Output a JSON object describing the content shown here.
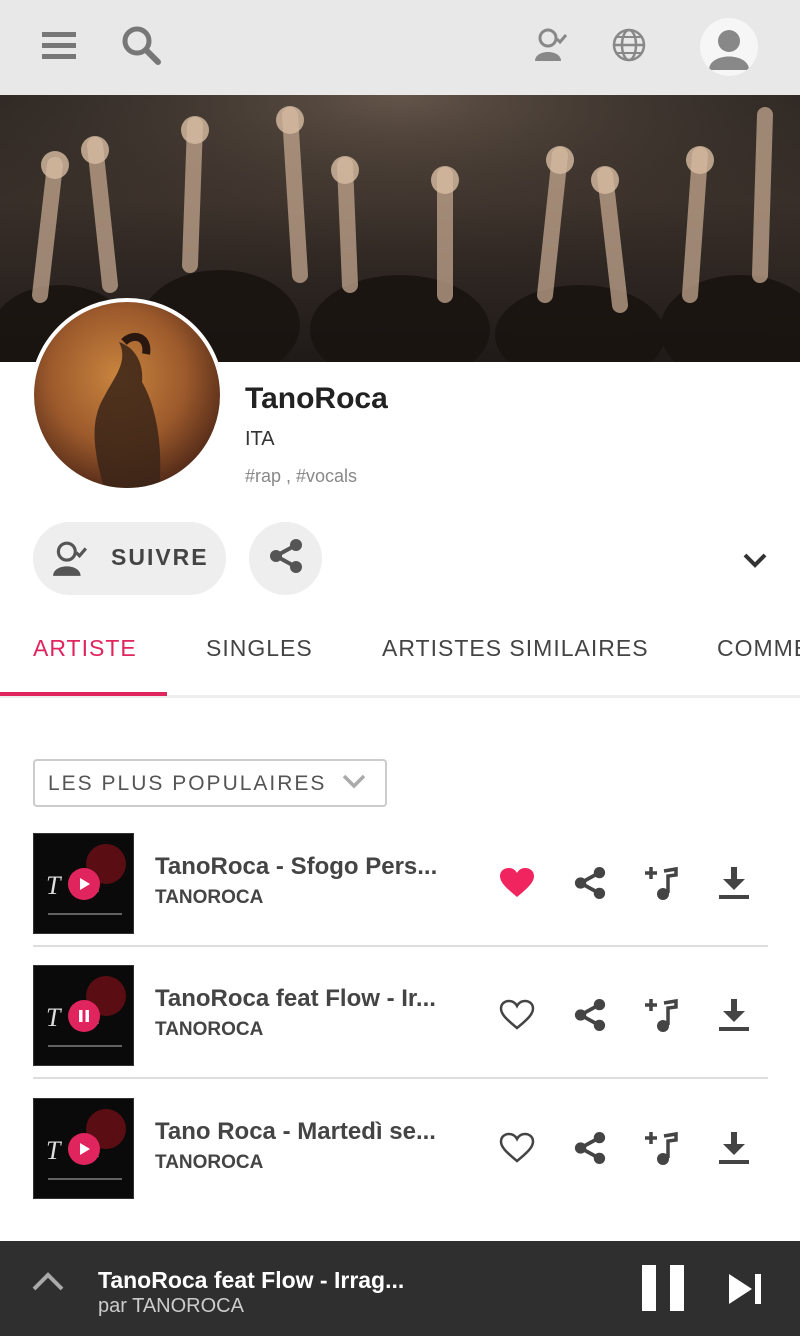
{
  "topbar": {
    "menu_icon": "hamburger-icon",
    "search_icon": "search-icon",
    "user_icon": "user-follow-icon",
    "globe_icon": "globe-icon",
    "avatar_icon": "avatar-icon"
  },
  "artist": {
    "name": "TanoRoca",
    "country": "ITA",
    "tags": "#rap , #vocals"
  },
  "actions": {
    "follow_label": "SUIVRE"
  },
  "tabs": [
    {
      "label": "ARTISTE",
      "active": true
    },
    {
      "label": "SINGLES",
      "active": false
    },
    {
      "label": "ARTISTES SIMILAIRES",
      "active": false
    },
    {
      "label": "COMMENTAIRES",
      "active": false
    }
  ],
  "sort": {
    "label": "LES PLUS POPULAIRES"
  },
  "tracks": [
    {
      "title": "TanoRoca - Sfogo Pers...",
      "artist": "TANOROCA",
      "liked": true,
      "state": "play"
    },
    {
      "title": "TanoRoca feat Flow - Ir...",
      "artist": "TANOROCA",
      "liked": false,
      "state": "pause"
    },
    {
      "title": "Tano Roca - Martedì se...",
      "artist": "TANOROCA",
      "liked": false,
      "state": "play"
    }
  ],
  "player": {
    "title": "TanoRoca feat Flow - Irrag...",
    "artist": "par TANOROCA"
  },
  "colors": {
    "accent": "#e0245e",
    "topbar_bg": "#e8e8e8",
    "player_bg": "#2f2f2f"
  }
}
